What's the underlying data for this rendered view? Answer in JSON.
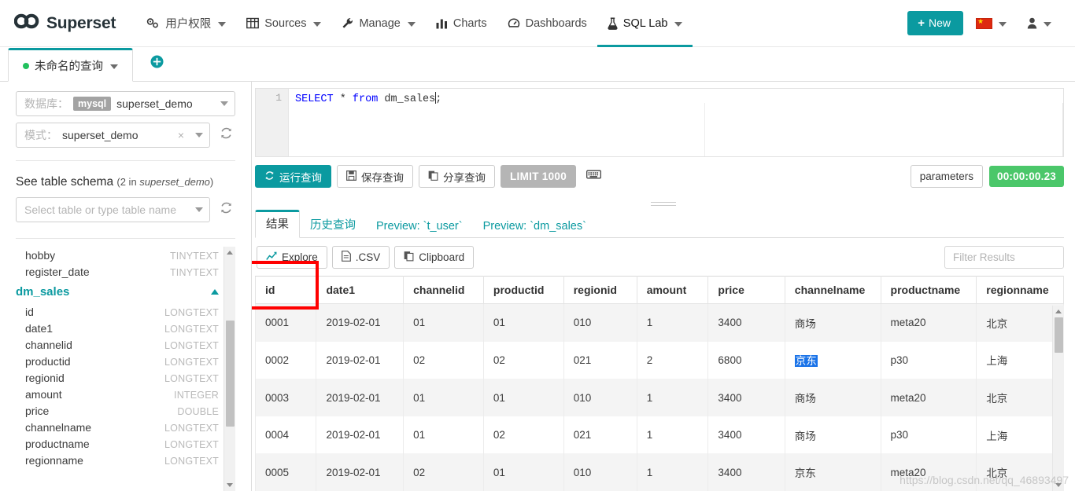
{
  "navbar": {
    "brand": "Superset",
    "brand_icon": "infinity-logo-icon",
    "items": [
      {
        "label": "用户权限",
        "icon": "gears-icon",
        "caret": true,
        "active": false
      },
      {
        "label": "Sources",
        "icon": "table-grid-icon",
        "caret": true,
        "active": false
      },
      {
        "label": "Manage",
        "icon": "wrench-icon",
        "caret": true,
        "active": false
      },
      {
        "label": "Charts",
        "icon": "bar-chart-icon",
        "caret": false,
        "active": false
      },
      {
        "label": "Dashboards",
        "icon": "dashboard-icon",
        "caret": false,
        "active": false
      },
      {
        "label": "SQL Lab",
        "icon": "flask-icon",
        "caret": true,
        "active": true
      }
    ],
    "new_button": {
      "label": "New",
      "plus": "+"
    },
    "language_icon": "china-flag-icon",
    "user_icon": "user-icon",
    "accent_color": "#0b9aa0"
  },
  "query_tabs": {
    "active_tab": {
      "label": "未命名的查询",
      "status_color": "#22c15e"
    },
    "add_tab_icon": "plus-circle-icon"
  },
  "left_panel": {
    "database": {
      "label": "数据库：",
      "badge": "mysql",
      "value": "superset_demo"
    },
    "schema": {
      "label": "模式：",
      "value": "superset_demo",
      "clear_icon": "×"
    },
    "refresh_icon": "refresh-icon",
    "see_table_schema": {
      "title": "See table schema",
      "count_prefix": "(2 in ",
      "count_schema": "superset_demo",
      "count_suffix": ")"
    },
    "table_select_placeholder": "Select table or type table name",
    "columns_above": [
      {
        "name": "hobby",
        "type": "TINYTEXT"
      },
      {
        "name": "register_date",
        "type": "TINYTEXT"
      }
    ],
    "table_group": {
      "name": "dm_sales",
      "expanded": true
    },
    "columns": [
      {
        "name": "id",
        "type": "LONGTEXT"
      },
      {
        "name": "date1",
        "type": "LONGTEXT"
      },
      {
        "name": "channelid",
        "type": "LONGTEXT"
      },
      {
        "name": "productid",
        "type": "LONGTEXT"
      },
      {
        "name": "regionid",
        "type": "LONGTEXT"
      },
      {
        "name": "amount",
        "type": "INTEGER"
      },
      {
        "name": "price",
        "type": "DOUBLE"
      },
      {
        "name": "channelname",
        "type": "LONGTEXT"
      },
      {
        "name": "productname",
        "type": "LONGTEXT"
      },
      {
        "name": "regionname",
        "type": "LONGTEXT"
      }
    ]
  },
  "editor": {
    "line_number": "1",
    "sql_keyword": "SELECT",
    "sql_star": " * ",
    "sql_from": "from",
    "sql_table": " dm_sales",
    "sql_semicolon": ";"
  },
  "toolbar": {
    "run_label": "运行查询",
    "run_icon": "refresh-icon",
    "save_label": "保存查询",
    "save_icon": "floppy-icon",
    "share_label": "分享查询",
    "share_icon": "copy-icon",
    "limit_label": "LIMIT 1000",
    "keyboard_icon": "keyboard-icon",
    "parameters_label": "parameters",
    "timer": "00:00:00.23",
    "timer_color": "#4bc76a"
  },
  "results": {
    "tabs": [
      {
        "label": "结果",
        "active": true
      },
      {
        "label": "历史查询",
        "active": false
      },
      {
        "label": "Preview: `t_user`",
        "active": false
      },
      {
        "label": "Preview: `dm_sales`",
        "active": false
      }
    ],
    "actions": [
      {
        "label": "Explore",
        "icon": "line-chart-icon"
      },
      {
        "label": ".CSV",
        "icon": "file-icon"
      },
      {
        "label": "Clipboard",
        "icon": "clipboard-icon"
      }
    ],
    "filter_placeholder": "Filter Results",
    "columns": [
      "id",
      "date1",
      "channelid",
      "productid",
      "regionid",
      "amount",
      "price",
      "channelname",
      "productname",
      "regionname"
    ],
    "rows": [
      [
        "0001",
        "2019-02-01",
        "01",
        "01",
        "010",
        "1",
        "3400",
        "商场",
        "meta20",
        "北京"
      ],
      [
        "0002",
        "2019-02-01",
        "02",
        "02",
        "021",
        "2",
        "6800",
        "京东",
        "p30",
        "上海"
      ],
      [
        "0003",
        "2019-02-01",
        "01",
        "01",
        "010",
        "1",
        "3400",
        "商场",
        "meta20",
        "北京"
      ],
      [
        "0004",
        "2019-02-01",
        "01",
        "02",
        "021",
        "1",
        "3400",
        "商场",
        "p30",
        "上海"
      ],
      [
        "0005",
        "2019-02-01",
        "02",
        "01",
        "010",
        "1",
        "3400",
        "京东",
        "meta20",
        "北京"
      ]
    ],
    "selected_cell": {
      "row": 1,
      "col": 7
    }
  },
  "annotation": {
    "color": "#ff0000"
  },
  "watermark": "https://blog.csdn.net/qq_46893497"
}
